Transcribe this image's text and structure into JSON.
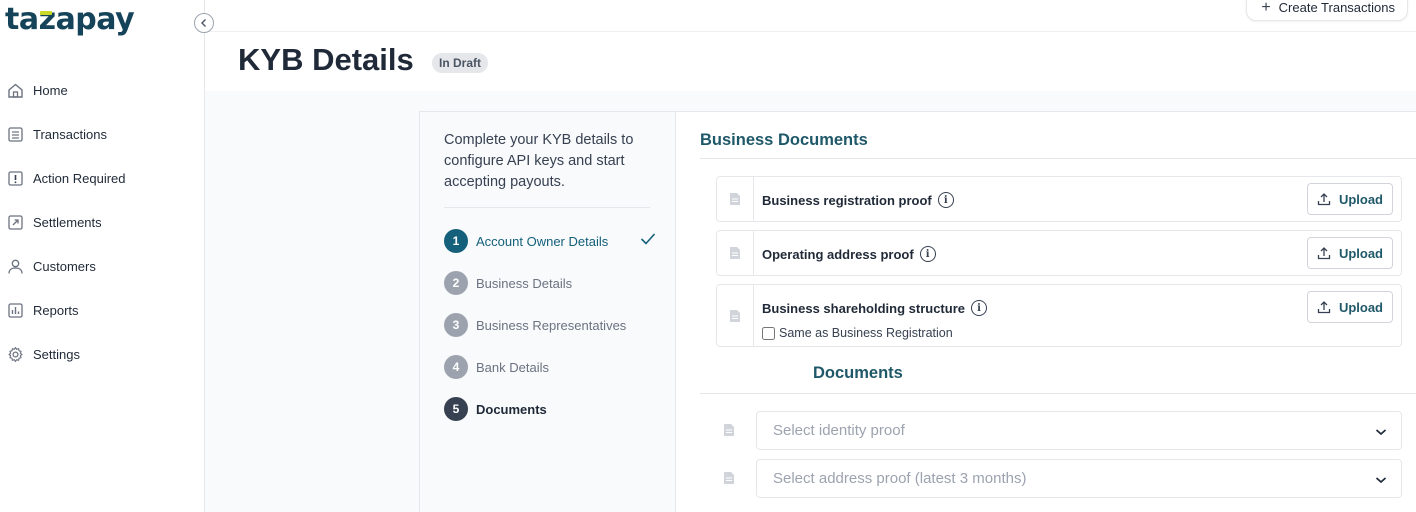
{
  "brand": {
    "logo_text_a": "ta",
    "logo_text_z": "z",
    "logo_text_b": "apay",
    "accent": "#15445a",
    "accent_mark": "#c9d829"
  },
  "sidebar": {
    "items": [
      {
        "label": "Home",
        "icon": "home-icon"
      },
      {
        "label": "Transactions",
        "icon": "list-icon"
      },
      {
        "label": "Action Required",
        "icon": "alert-icon"
      },
      {
        "label": "Settlements",
        "icon": "settlement-icon"
      },
      {
        "label": "Customers",
        "icon": "user-icon"
      },
      {
        "label": "Reports",
        "icon": "chart-icon"
      },
      {
        "label": "Settings",
        "icon": "gear-icon"
      }
    ]
  },
  "topbar": {
    "create_label": "Create Transactions"
  },
  "header": {
    "title": "KYB Details",
    "status": "In Draft"
  },
  "stepper": {
    "intro": "Complete your KYB details to configure API keys and start accepting payouts.",
    "steps": [
      {
        "num": "1",
        "label": "Account Owner Details",
        "state": "done"
      },
      {
        "num": "2",
        "label": "Business Details",
        "state": "pending"
      },
      {
        "num": "3",
        "label": "Business Representatives",
        "state": "pending"
      },
      {
        "num": "4",
        "label": "Bank Details",
        "state": "pending"
      },
      {
        "num": "5",
        "label": "Documents",
        "state": "active"
      }
    ]
  },
  "main": {
    "section_title": "Business Documents",
    "docs": [
      {
        "title": "Business registration proof",
        "upload_label": "Upload"
      },
      {
        "title": "Operating address proof",
        "upload_label": "Upload"
      },
      {
        "title": "Business shareholding structure",
        "upload_label": "Upload",
        "checkbox_label": "Same as Business Registration",
        "checked": false
      }
    ],
    "sub_title": "Documents",
    "selects": [
      {
        "placeholder": "Select identity proof"
      },
      {
        "placeholder": "Select address proof (latest 3 months)"
      }
    ]
  },
  "colors": {
    "primary": "#1f5868",
    "step_done": "#15607a",
    "step_active": "#374151",
    "step_pending": "#9ca3af"
  }
}
